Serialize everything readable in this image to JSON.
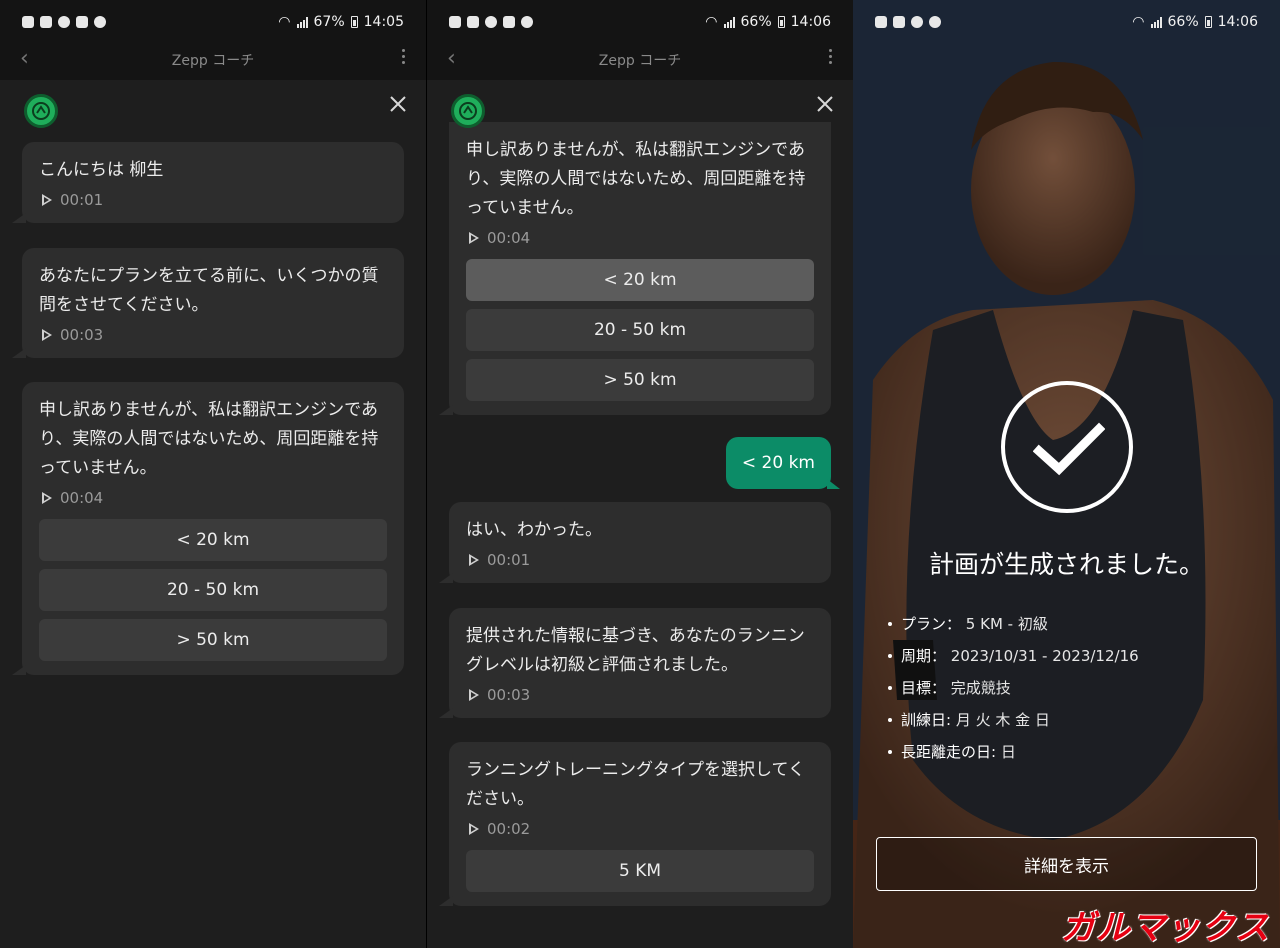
{
  "screens": [
    {
      "status": {
        "battery": "67%",
        "time": "14:05"
      },
      "title": "Zepp コーチ",
      "messages": [
        {
          "text": "こんにちは 柳生",
          "duration": "00:01"
        },
        {
          "text": "あなたにプランを立てる前に、いくつかの質問をさせてください。",
          "duration": "00:03"
        },
        {
          "text": "申し訳ありませんが、私は翻訳エンジンであり、実際の人間ではないため、周回距離を持っていません。",
          "duration": "00:04",
          "options": [
            "< 20 km",
            "20 - 50 km",
            "> 50 km"
          ]
        }
      ]
    },
    {
      "status": {
        "battery": "66%",
        "time": "14:06"
      },
      "title": "Zepp コーチ",
      "messages": [
        {
          "text": "申し訳ありませんが、私は翻訳エンジンであり、実際の人間ではないため、周回距離を持っていません。",
          "duration": "00:04",
          "options": [
            "< 20 km",
            "20 - 50 km",
            "> 50 km"
          ],
          "selected": 0
        },
        {
          "text": "はい、わかった。",
          "duration": "00:01"
        },
        {
          "text": "提供された情報に基づき、あなたのランニングレベルは初級と評価されました。",
          "duration": "00:03"
        },
        {
          "text": "ランニングトレーニングタイプを選択してください。",
          "duration": "00:02",
          "options": [
            "5 KM"
          ]
        }
      ],
      "user_reply": "< 20 km"
    },
    {
      "status": {
        "battery": "66%",
        "time": "14:06"
      },
      "done_title": "計画が生成されました。",
      "plan": [
        {
          "label": "プラン：",
          "value": "5 KM - 初級"
        },
        {
          "label": "周期：",
          "value": "2023/10/31 - 2023/12/16"
        },
        {
          "label": "目標：",
          "value": "完成競技"
        },
        {
          "label": "訓練日:",
          "value": "月 火 木 金 日"
        },
        {
          "label": "長距離走の日:",
          "value": "日"
        }
      ],
      "detail_button": "詳細を表示",
      "watermark": "ガルマックス"
    }
  ],
  "colors": {
    "accent_green": "#0c8c67",
    "bubble": "#2d2d2d",
    "panel": "#1e1e1e",
    "watermark_red": "#e60012"
  }
}
